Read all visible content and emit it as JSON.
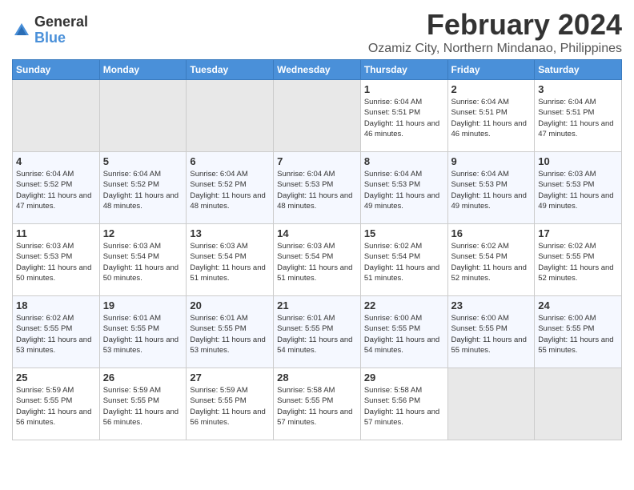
{
  "logo": {
    "general": "General",
    "blue": "Blue"
  },
  "title": "February 2024",
  "location": "Ozamiz City, Northern Mindanao, Philippines",
  "days_of_week": [
    "Sunday",
    "Monday",
    "Tuesday",
    "Wednesday",
    "Thursday",
    "Friday",
    "Saturday"
  ],
  "weeks": [
    [
      {
        "day": "",
        "sunrise": "",
        "sunset": "",
        "daylight": "",
        "empty": true
      },
      {
        "day": "",
        "sunrise": "",
        "sunset": "",
        "daylight": "",
        "empty": true
      },
      {
        "day": "",
        "sunrise": "",
        "sunset": "",
        "daylight": "",
        "empty": true
      },
      {
        "day": "",
        "sunrise": "",
        "sunset": "",
        "daylight": "",
        "empty": true
      },
      {
        "day": "1",
        "sunrise": "Sunrise: 6:04 AM",
        "sunset": "Sunset: 5:51 PM",
        "daylight": "Daylight: 11 hours and 46 minutes.",
        "empty": false
      },
      {
        "day": "2",
        "sunrise": "Sunrise: 6:04 AM",
        "sunset": "Sunset: 5:51 PM",
        "daylight": "Daylight: 11 hours and 46 minutes.",
        "empty": false
      },
      {
        "day": "3",
        "sunrise": "Sunrise: 6:04 AM",
        "sunset": "Sunset: 5:51 PM",
        "daylight": "Daylight: 11 hours and 47 minutes.",
        "empty": false
      }
    ],
    [
      {
        "day": "4",
        "sunrise": "Sunrise: 6:04 AM",
        "sunset": "Sunset: 5:52 PM",
        "daylight": "Daylight: 11 hours and 47 minutes.",
        "empty": false
      },
      {
        "day": "5",
        "sunrise": "Sunrise: 6:04 AM",
        "sunset": "Sunset: 5:52 PM",
        "daylight": "Daylight: 11 hours and 48 minutes.",
        "empty": false
      },
      {
        "day": "6",
        "sunrise": "Sunrise: 6:04 AM",
        "sunset": "Sunset: 5:52 PM",
        "daylight": "Daylight: 11 hours and 48 minutes.",
        "empty": false
      },
      {
        "day": "7",
        "sunrise": "Sunrise: 6:04 AM",
        "sunset": "Sunset: 5:53 PM",
        "daylight": "Daylight: 11 hours and 48 minutes.",
        "empty": false
      },
      {
        "day": "8",
        "sunrise": "Sunrise: 6:04 AM",
        "sunset": "Sunset: 5:53 PM",
        "daylight": "Daylight: 11 hours and 49 minutes.",
        "empty": false
      },
      {
        "day": "9",
        "sunrise": "Sunrise: 6:04 AM",
        "sunset": "Sunset: 5:53 PM",
        "daylight": "Daylight: 11 hours and 49 minutes.",
        "empty": false
      },
      {
        "day": "10",
        "sunrise": "Sunrise: 6:03 AM",
        "sunset": "Sunset: 5:53 PM",
        "daylight": "Daylight: 11 hours and 49 minutes.",
        "empty": false
      }
    ],
    [
      {
        "day": "11",
        "sunrise": "Sunrise: 6:03 AM",
        "sunset": "Sunset: 5:53 PM",
        "daylight": "Daylight: 11 hours and 50 minutes.",
        "empty": false
      },
      {
        "day": "12",
        "sunrise": "Sunrise: 6:03 AM",
        "sunset": "Sunset: 5:54 PM",
        "daylight": "Daylight: 11 hours and 50 minutes.",
        "empty": false
      },
      {
        "day": "13",
        "sunrise": "Sunrise: 6:03 AM",
        "sunset": "Sunset: 5:54 PM",
        "daylight": "Daylight: 11 hours and 51 minutes.",
        "empty": false
      },
      {
        "day": "14",
        "sunrise": "Sunrise: 6:03 AM",
        "sunset": "Sunset: 5:54 PM",
        "daylight": "Daylight: 11 hours and 51 minutes.",
        "empty": false
      },
      {
        "day": "15",
        "sunrise": "Sunrise: 6:02 AM",
        "sunset": "Sunset: 5:54 PM",
        "daylight": "Daylight: 11 hours and 51 minutes.",
        "empty": false
      },
      {
        "day": "16",
        "sunrise": "Sunrise: 6:02 AM",
        "sunset": "Sunset: 5:54 PM",
        "daylight": "Daylight: 11 hours and 52 minutes.",
        "empty": false
      },
      {
        "day": "17",
        "sunrise": "Sunrise: 6:02 AM",
        "sunset": "Sunset: 5:55 PM",
        "daylight": "Daylight: 11 hours and 52 minutes.",
        "empty": false
      }
    ],
    [
      {
        "day": "18",
        "sunrise": "Sunrise: 6:02 AM",
        "sunset": "Sunset: 5:55 PM",
        "daylight": "Daylight: 11 hours and 53 minutes.",
        "empty": false
      },
      {
        "day": "19",
        "sunrise": "Sunrise: 6:01 AM",
        "sunset": "Sunset: 5:55 PM",
        "daylight": "Daylight: 11 hours and 53 minutes.",
        "empty": false
      },
      {
        "day": "20",
        "sunrise": "Sunrise: 6:01 AM",
        "sunset": "Sunset: 5:55 PM",
        "daylight": "Daylight: 11 hours and 53 minutes.",
        "empty": false
      },
      {
        "day": "21",
        "sunrise": "Sunrise: 6:01 AM",
        "sunset": "Sunset: 5:55 PM",
        "daylight": "Daylight: 11 hours and 54 minutes.",
        "empty": false
      },
      {
        "day": "22",
        "sunrise": "Sunrise: 6:00 AM",
        "sunset": "Sunset: 5:55 PM",
        "daylight": "Daylight: 11 hours and 54 minutes.",
        "empty": false
      },
      {
        "day": "23",
        "sunrise": "Sunrise: 6:00 AM",
        "sunset": "Sunset: 5:55 PM",
        "daylight": "Daylight: 11 hours and 55 minutes.",
        "empty": false
      },
      {
        "day": "24",
        "sunrise": "Sunrise: 6:00 AM",
        "sunset": "Sunset: 5:55 PM",
        "daylight": "Daylight: 11 hours and 55 minutes.",
        "empty": false
      }
    ],
    [
      {
        "day": "25",
        "sunrise": "Sunrise: 5:59 AM",
        "sunset": "Sunset: 5:55 PM",
        "daylight": "Daylight: 11 hours and 56 minutes.",
        "empty": false
      },
      {
        "day": "26",
        "sunrise": "Sunrise: 5:59 AM",
        "sunset": "Sunset: 5:55 PM",
        "daylight": "Daylight: 11 hours and 56 minutes.",
        "empty": false
      },
      {
        "day": "27",
        "sunrise": "Sunrise: 5:59 AM",
        "sunset": "Sunset: 5:55 PM",
        "daylight": "Daylight: 11 hours and 56 minutes.",
        "empty": false
      },
      {
        "day": "28",
        "sunrise": "Sunrise: 5:58 AM",
        "sunset": "Sunset: 5:55 PM",
        "daylight": "Daylight: 11 hours and 57 minutes.",
        "empty": false
      },
      {
        "day": "29",
        "sunrise": "Sunrise: 5:58 AM",
        "sunset": "Sunset: 5:56 PM",
        "daylight": "Daylight: 11 hours and 57 minutes.",
        "empty": false
      },
      {
        "day": "",
        "sunrise": "",
        "sunset": "",
        "daylight": "",
        "empty": true
      },
      {
        "day": "",
        "sunrise": "",
        "sunset": "",
        "daylight": "",
        "empty": true
      }
    ]
  ]
}
